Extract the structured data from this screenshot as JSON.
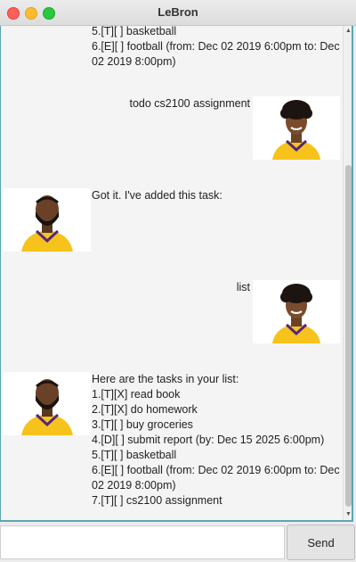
{
  "window": {
    "title": "LeBron"
  },
  "messages": [
    {
      "from": "bot",
      "lines": [
        "5.[T][ ] basketball",
        "6.[E][ ] football (from: Dec 02 2019 6:00pm to: Dec",
        "02 2019 8:00pm)"
      ]
    },
    {
      "from": "user",
      "text": "todo cs2100 assignment"
    },
    {
      "from": "bot",
      "text": "Got it. I've added this task:"
    },
    {
      "from": "user",
      "text": "list"
    },
    {
      "from": "bot",
      "lines": [
        "Here are the tasks in your list:",
        "1.[T][X] read book",
        "2.[T][X] do homework",
        "3.[T][ ] buy groceries",
        "4.[D][ ] submit report (by: Dec 15 2025 6:00pm)",
        "5.[T][ ] basketball",
        "6.[E][ ] football (from: Dec 02 2019 6:00pm to: Dec",
        "02 2019 8:00pm)",
        "7.[T][ ] cs2100 assignment"
      ]
    }
  ],
  "input": {
    "value": "",
    "placeholder": ""
  },
  "send_button": {
    "label": "Send"
  },
  "colors": {
    "border_accent": "#5aa7b3",
    "jersey": "#f5c31c",
    "jersey_trim": "#552583"
  }
}
